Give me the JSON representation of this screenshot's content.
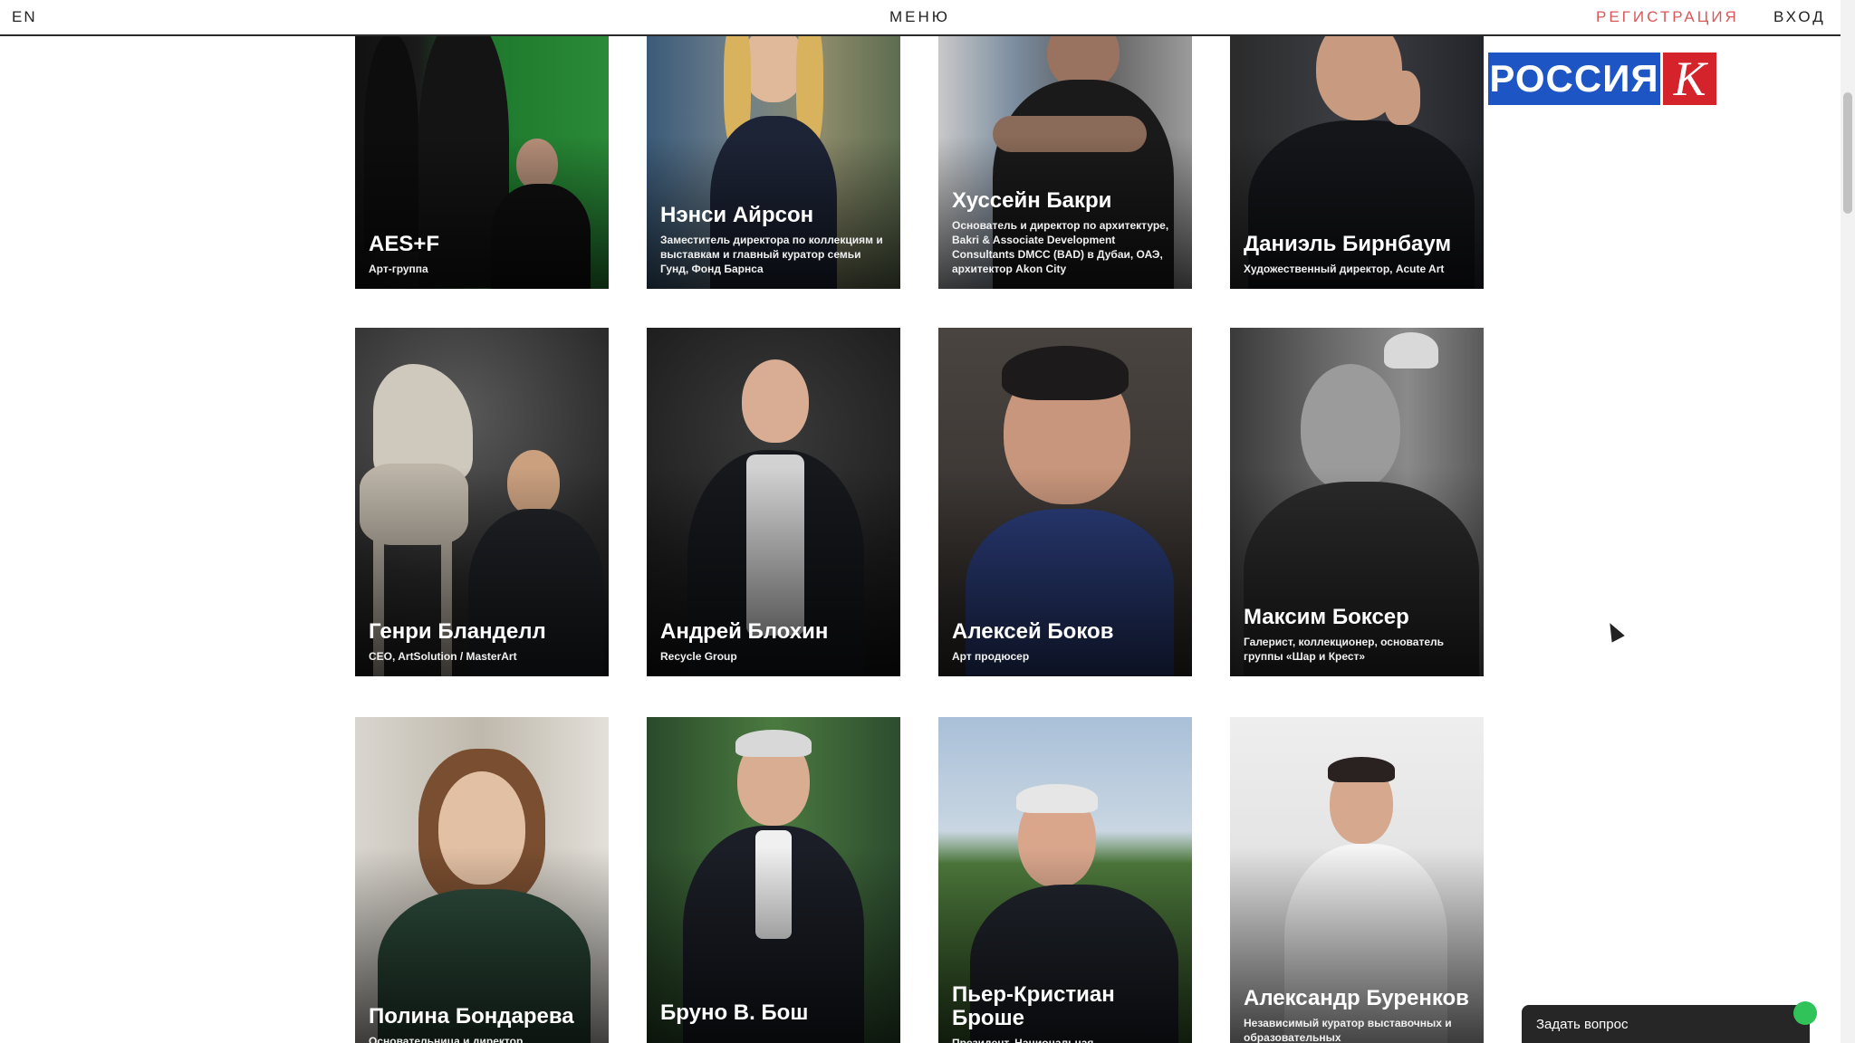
{
  "header": {
    "lang": "EN",
    "menu": "МЕНЮ",
    "register": "РЕГИСТРАЦИЯ",
    "login": "ВХОД"
  },
  "logo": {
    "text": "РОССИЯ",
    "letter": "К"
  },
  "people": [
    {
      "name": "AES+F",
      "role": "Арт-группа"
    },
    {
      "name": "Нэнси Айрсон",
      "role": "Заместитель директора по коллекциям и выставкам и главный куратор семьи Гунд, Фонд Барнса"
    },
    {
      "name": "Хуссейн Бакри",
      "role": "Основатель и директор по архитектуре, Bakri & Associate Development Consultants DMCC (BAD) в Дубаи, ОАЭ, архитектор Akon City"
    },
    {
      "name": "Даниэль Бирнбаум",
      "role": "Художественный директор, Acute Art"
    },
    {
      "name": "Генри Бланделл",
      "role": "CEO, ArtSolution / MasterArt"
    },
    {
      "name": "Андрей Блохин",
      "role": "Recycle Group"
    },
    {
      "name": "Алексей Боков",
      "role": "Арт продюсер"
    },
    {
      "name": "Максим Боксер",
      "role": "Галерист, коллекционер, основатель группы «Шар и Крест»"
    },
    {
      "name": "Полина Бондарева",
      "role": "Основательница и директор,"
    },
    {
      "name": "Бруно В. Бош",
      "role": ""
    },
    {
      "name": "Пьер-Кристиан Броше",
      "role": "Президент, Национальная"
    },
    {
      "name": "Александр Буренков",
      "role": "Независимый куратор выставочных и образовательных"
    }
  ],
  "chat": {
    "label": "Задать вопрос"
  },
  "colors": {
    "accent": "#d9575a",
    "brand_blue": "#1d56c4",
    "brand_red": "#d5232b",
    "chat_online": "#2fc35a"
  }
}
